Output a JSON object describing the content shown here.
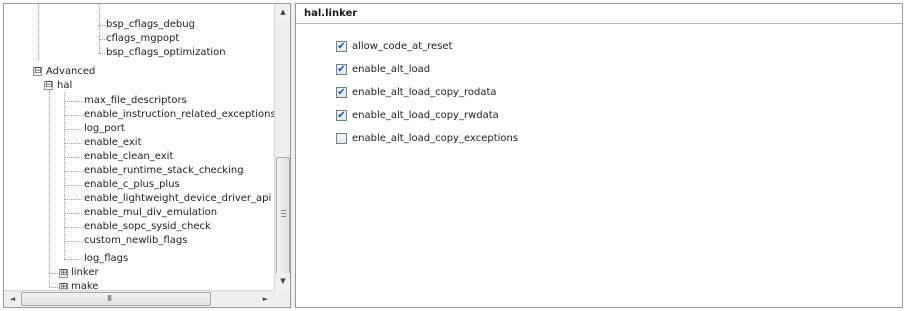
{
  "tree": {
    "nodes": [
      {
        "label": "bsp_cflags_debug",
        "type": "leaf"
      },
      {
        "label": "cflags_mgpopt",
        "type": "leaf"
      },
      {
        "label": "bsp_cflags_optimization",
        "type": "leaf"
      },
      {
        "label": "Advanced",
        "type": "expanded"
      },
      {
        "label": "hal",
        "type": "expanded"
      },
      {
        "label": "max_file_descriptors",
        "type": "leaf"
      },
      {
        "label": "enable_instruction_related_exceptions",
        "type": "leaf"
      },
      {
        "label": "log_port",
        "type": "leaf"
      },
      {
        "label": "enable_exit",
        "type": "leaf"
      },
      {
        "label": "enable_clean_exit",
        "type": "leaf"
      },
      {
        "label": "enable_runtime_stack_checking",
        "type": "leaf"
      },
      {
        "label": "enable_c_plus_plus",
        "type": "leaf"
      },
      {
        "label": "enable_lightweight_device_driver_api",
        "type": "leaf"
      },
      {
        "label": "enable_mul_div_emulation",
        "type": "leaf"
      },
      {
        "label": "enable_sopc_sysid_check",
        "type": "leaf"
      },
      {
        "label": "custom_newlib_flags",
        "type": "leaf"
      },
      {
        "label": "log_flags",
        "type": "leaf"
      },
      {
        "label": "linker",
        "type": "collapsed"
      },
      {
        "label": "make",
        "type": "collapsed"
      }
    ],
    "expand_symbol": "⊟",
    "collapse_symbol": "⊞"
  },
  "scroll": {
    "up_arrow": "▲",
    "down_arrow": "▼",
    "left_arrow": "◄",
    "right_arrow": "►",
    "h_grip": "III",
    "v_position": 0.72,
    "h_position": 0.0
  },
  "section": {
    "title": "hal.linker"
  },
  "options": [
    {
      "label": "allow_code_at_reset",
      "checked": true
    },
    {
      "label": "enable_alt_load",
      "checked": true
    },
    {
      "label": "enable_alt_load_copy_rodata",
      "checked": true
    },
    {
      "label": "enable_alt_load_copy_rwdata",
      "checked": true
    },
    {
      "label": "enable_alt_load_copy_exceptions",
      "checked": false
    }
  ],
  "colors": {
    "check_mark": "#1f4fb5",
    "panel_border": "#9a9a9a"
  }
}
